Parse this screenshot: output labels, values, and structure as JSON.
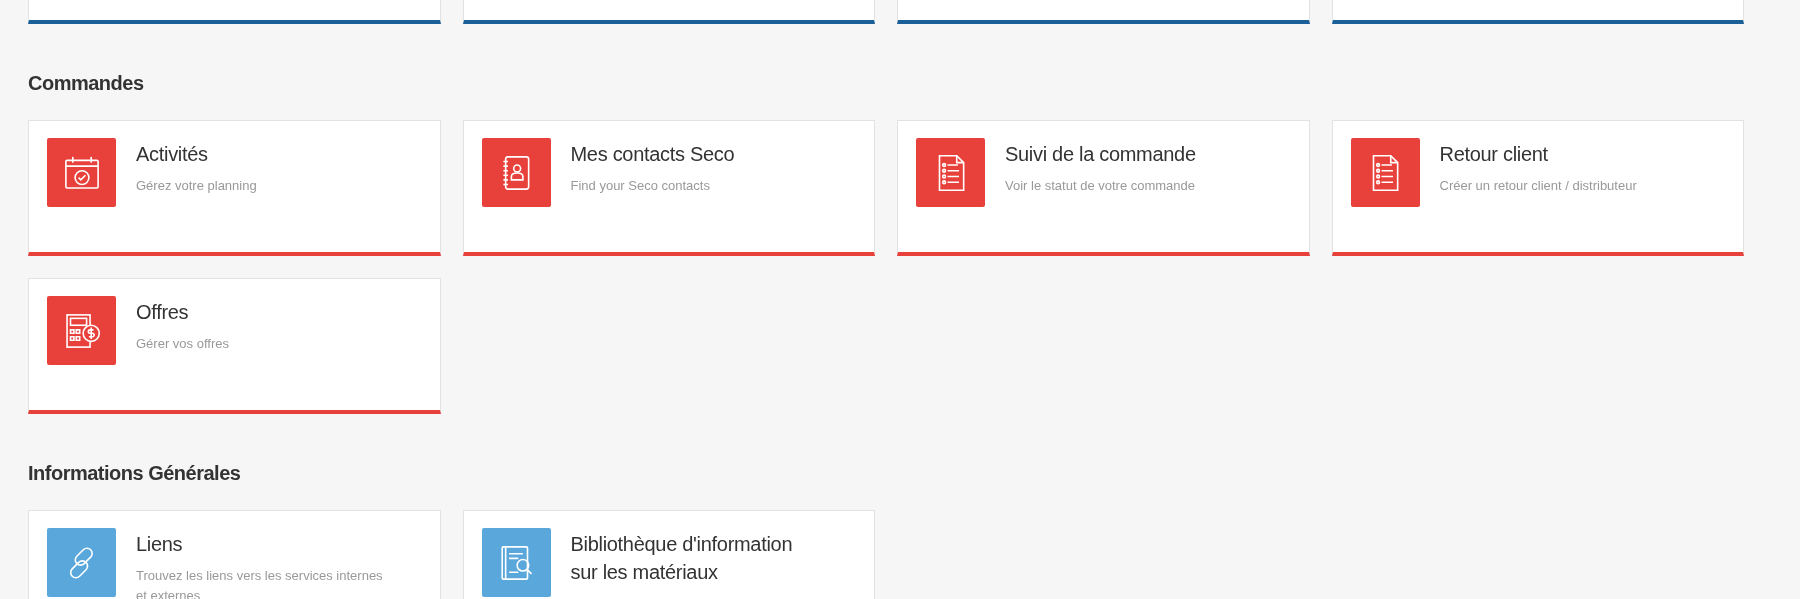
{
  "sections": [
    {
      "color": "#1b5f98",
      "cards": [
        {
          "kind": "stub"
        },
        {
          "kind": "stub"
        },
        {
          "kind": "stub"
        },
        {
          "kind": "stub"
        }
      ]
    },
    {
      "title": "Commandes",
      "color": "#e8403a",
      "cards": [
        {
          "kind": "calendar",
          "title": "Activités",
          "description": "Gérez votre planning"
        },
        {
          "kind": "contacts",
          "title": "Mes contacts Seco",
          "description": "Find your Seco contacts"
        },
        {
          "kind": "list",
          "title": "Suivi de la commande",
          "description": "Voir le statut de votre commande"
        },
        {
          "kind": "list",
          "title": "Retour client",
          "description": "Créer un retour client / distributeur"
        },
        {
          "kind": "calculator",
          "title": "Offres",
          "description": "Gérer vos offres"
        }
      ]
    },
    {
      "title": "Informations Générales",
      "color": "#5aa7dc",
      "cards": [
        {
          "kind": "link",
          "title": "Liens",
          "description": "Trouvez les liens vers les services internes et externes"
        },
        {
          "kind": "library",
          "title": "Bibliothèque d'information sur les matériaux"
        }
      ]
    }
  ]
}
